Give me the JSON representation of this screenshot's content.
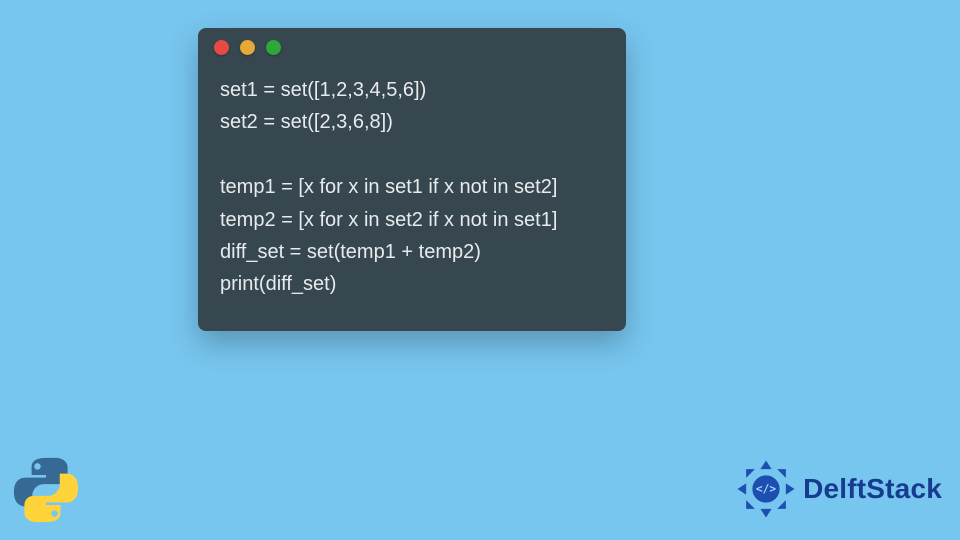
{
  "code_window": {
    "dots": [
      "red",
      "yellow",
      "green"
    ],
    "lines": [
      "set1 = set([1,2,3,4,5,6])",
      "set2 = set([2,3,6,8])",
      "",
      "temp1 = [x for x in set1 if x not in set2]",
      "temp2 = [x for x in set2 if x not in set1]",
      "diff_set = set(temp1 + temp2)",
      "print(diff_set)"
    ]
  },
  "brand": {
    "name": "DelftStack"
  },
  "icons": {
    "python": "python-logo-icon",
    "brand_mark": "delftstack-mark-icon"
  }
}
